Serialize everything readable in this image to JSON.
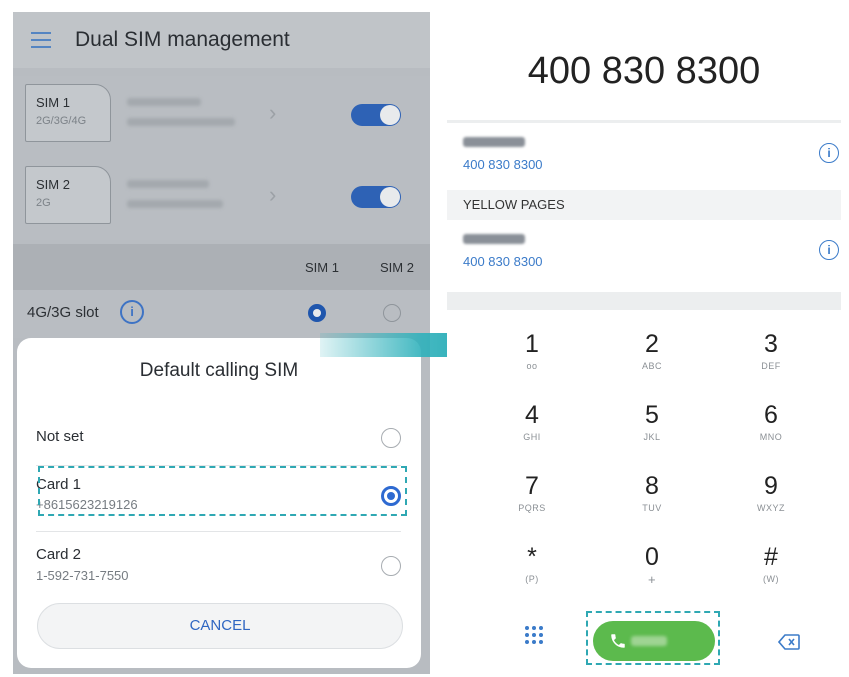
{
  "left": {
    "title": "Dual SIM management",
    "sims": [
      {
        "name": "SIM 1",
        "types": "2G/3G/4G",
        "enabled": true
      },
      {
        "name": "SIM 2",
        "types": "2G",
        "enabled": true
      }
    ],
    "slot_table": {
      "col1": "SIM 1",
      "col2": "SIM 2",
      "row_label": "4G/3G slot",
      "info_icon": "i",
      "selected": "SIM 1"
    },
    "dialog": {
      "title": "Default calling SIM",
      "options": [
        {
          "title": "Not set",
          "subtitle": "",
          "selected": false
        },
        {
          "title": "Card 1",
          "subtitle": "+8615623219126",
          "selected": true
        },
        {
          "title": "Card 2",
          "subtitle": "1-592-731-7550",
          "selected": false
        }
      ],
      "cancel_label": "CANCEL"
    }
  },
  "right": {
    "dialed_number": "400 830 8300",
    "results": [
      {
        "number": "400 830 8300",
        "info_icon": "i"
      },
      {
        "number": "400 830 8300",
        "info_icon": "i"
      }
    ],
    "section_header": "YELLOW PAGES",
    "keypad": [
      {
        "digit": "1",
        "letters": "oo"
      },
      {
        "digit": "2",
        "letters": "ABC"
      },
      {
        "digit": "3",
        "letters": "DEF"
      },
      {
        "digit": "4",
        "letters": "GHI"
      },
      {
        "digit": "5",
        "letters": "JKL"
      },
      {
        "digit": "6",
        "letters": "MNO"
      },
      {
        "digit": "7",
        "letters": "PQRS"
      },
      {
        "digit": "8",
        "letters": "TUV"
      },
      {
        "digit": "9",
        "letters": "WXYZ"
      },
      {
        "digit": "*",
        "letters": "(P)"
      },
      {
        "digit": "0",
        "letters": "+"
      },
      {
        "digit": "#",
        "letters": "(W)"
      }
    ],
    "bottom_icons": [
      "dialpad-icon",
      "call-icon",
      "backspace-icon"
    ]
  },
  "colors": {
    "accent_blue": "#2e62b5",
    "call_green": "#5cba4d",
    "highlight_teal": "#2fa8b3",
    "overlay_gray": "#b8bcc1"
  }
}
